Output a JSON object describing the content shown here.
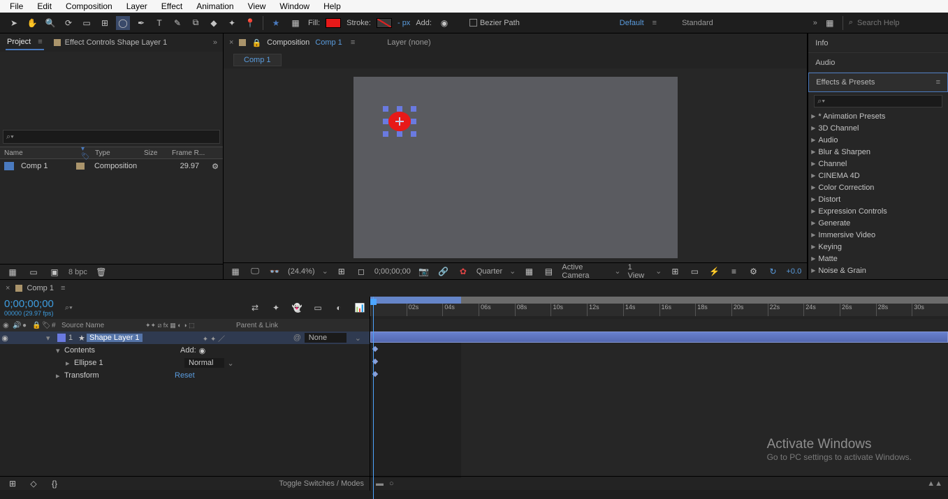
{
  "menu": [
    "File",
    "Edit",
    "Composition",
    "Layer",
    "Effect",
    "Animation",
    "View",
    "Window",
    "Help"
  ],
  "toolbar": {
    "fill_label": "Fill:",
    "stroke_label": "Stroke:",
    "stroke_px": "- px",
    "add_label": "Add:",
    "bezier_label": "Bezier Path",
    "workspace_default": "Default",
    "workspace_standard": "Standard",
    "search_placeholder": "Search Help"
  },
  "project": {
    "tab_project": "Project",
    "tab_effect_controls": "Effect Controls Shape Layer 1",
    "col_name": "Name",
    "col_type": "Type",
    "col_size": "Size",
    "col_frame": "Frame R...",
    "item_name": "Comp 1",
    "item_type": "Composition",
    "item_rate": "29.97",
    "bpc": "8 bpc"
  },
  "viewer": {
    "tab_composition": "Composition",
    "comp_name": "Comp 1",
    "tab_layer": "Layer  (none)",
    "sub_tab": "Comp 1",
    "zoom": "(24.4%)",
    "timecode": "0;00;00;00",
    "quality": "Quarter",
    "camera": "Active Camera",
    "view": "1 View",
    "exposure": "+0.0"
  },
  "right": {
    "info": "Info",
    "audio": "Audio",
    "effects_presets": "Effects & Presets",
    "categories": [
      "* Animation Presets",
      "3D Channel",
      "Audio",
      "Blur & Sharpen",
      "Channel",
      "CINEMA 4D",
      "Color Correction",
      "Distort",
      "Expression Controls",
      "Generate",
      "Immersive Video",
      "Keying",
      "Matte",
      "Noise & Grain"
    ]
  },
  "timeline": {
    "tab": "Comp 1",
    "timecode": "0;00;00;00",
    "timecode_sub": "00000 (29.97 fps)",
    "col_source": "Source Name",
    "col_parent": "Parent & Link",
    "layer_num": "1",
    "layer_name": "Shape Layer 1",
    "contents": "Contents",
    "add": "Add:",
    "ellipse": "Ellipse 1",
    "normal": "Normal",
    "transform": "Transform",
    "reset": "Reset",
    "none": "None",
    "toggle": "Toggle Switches / Modes",
    "ticks": [
      "",
      "02s",
      "04s",
      "06s",
      "08s",
      "10s",
      "12s",
      "14s",
      "16s",
      "18s",
      "20s",
      "22s",
      "24s",
      "26s",
      "28s",
      "30s"
    ]
  },
  "watermark": {
    "l1": "Activate Windows",
    "l2": "Go to PC settings to activate Windows."
  }
}
